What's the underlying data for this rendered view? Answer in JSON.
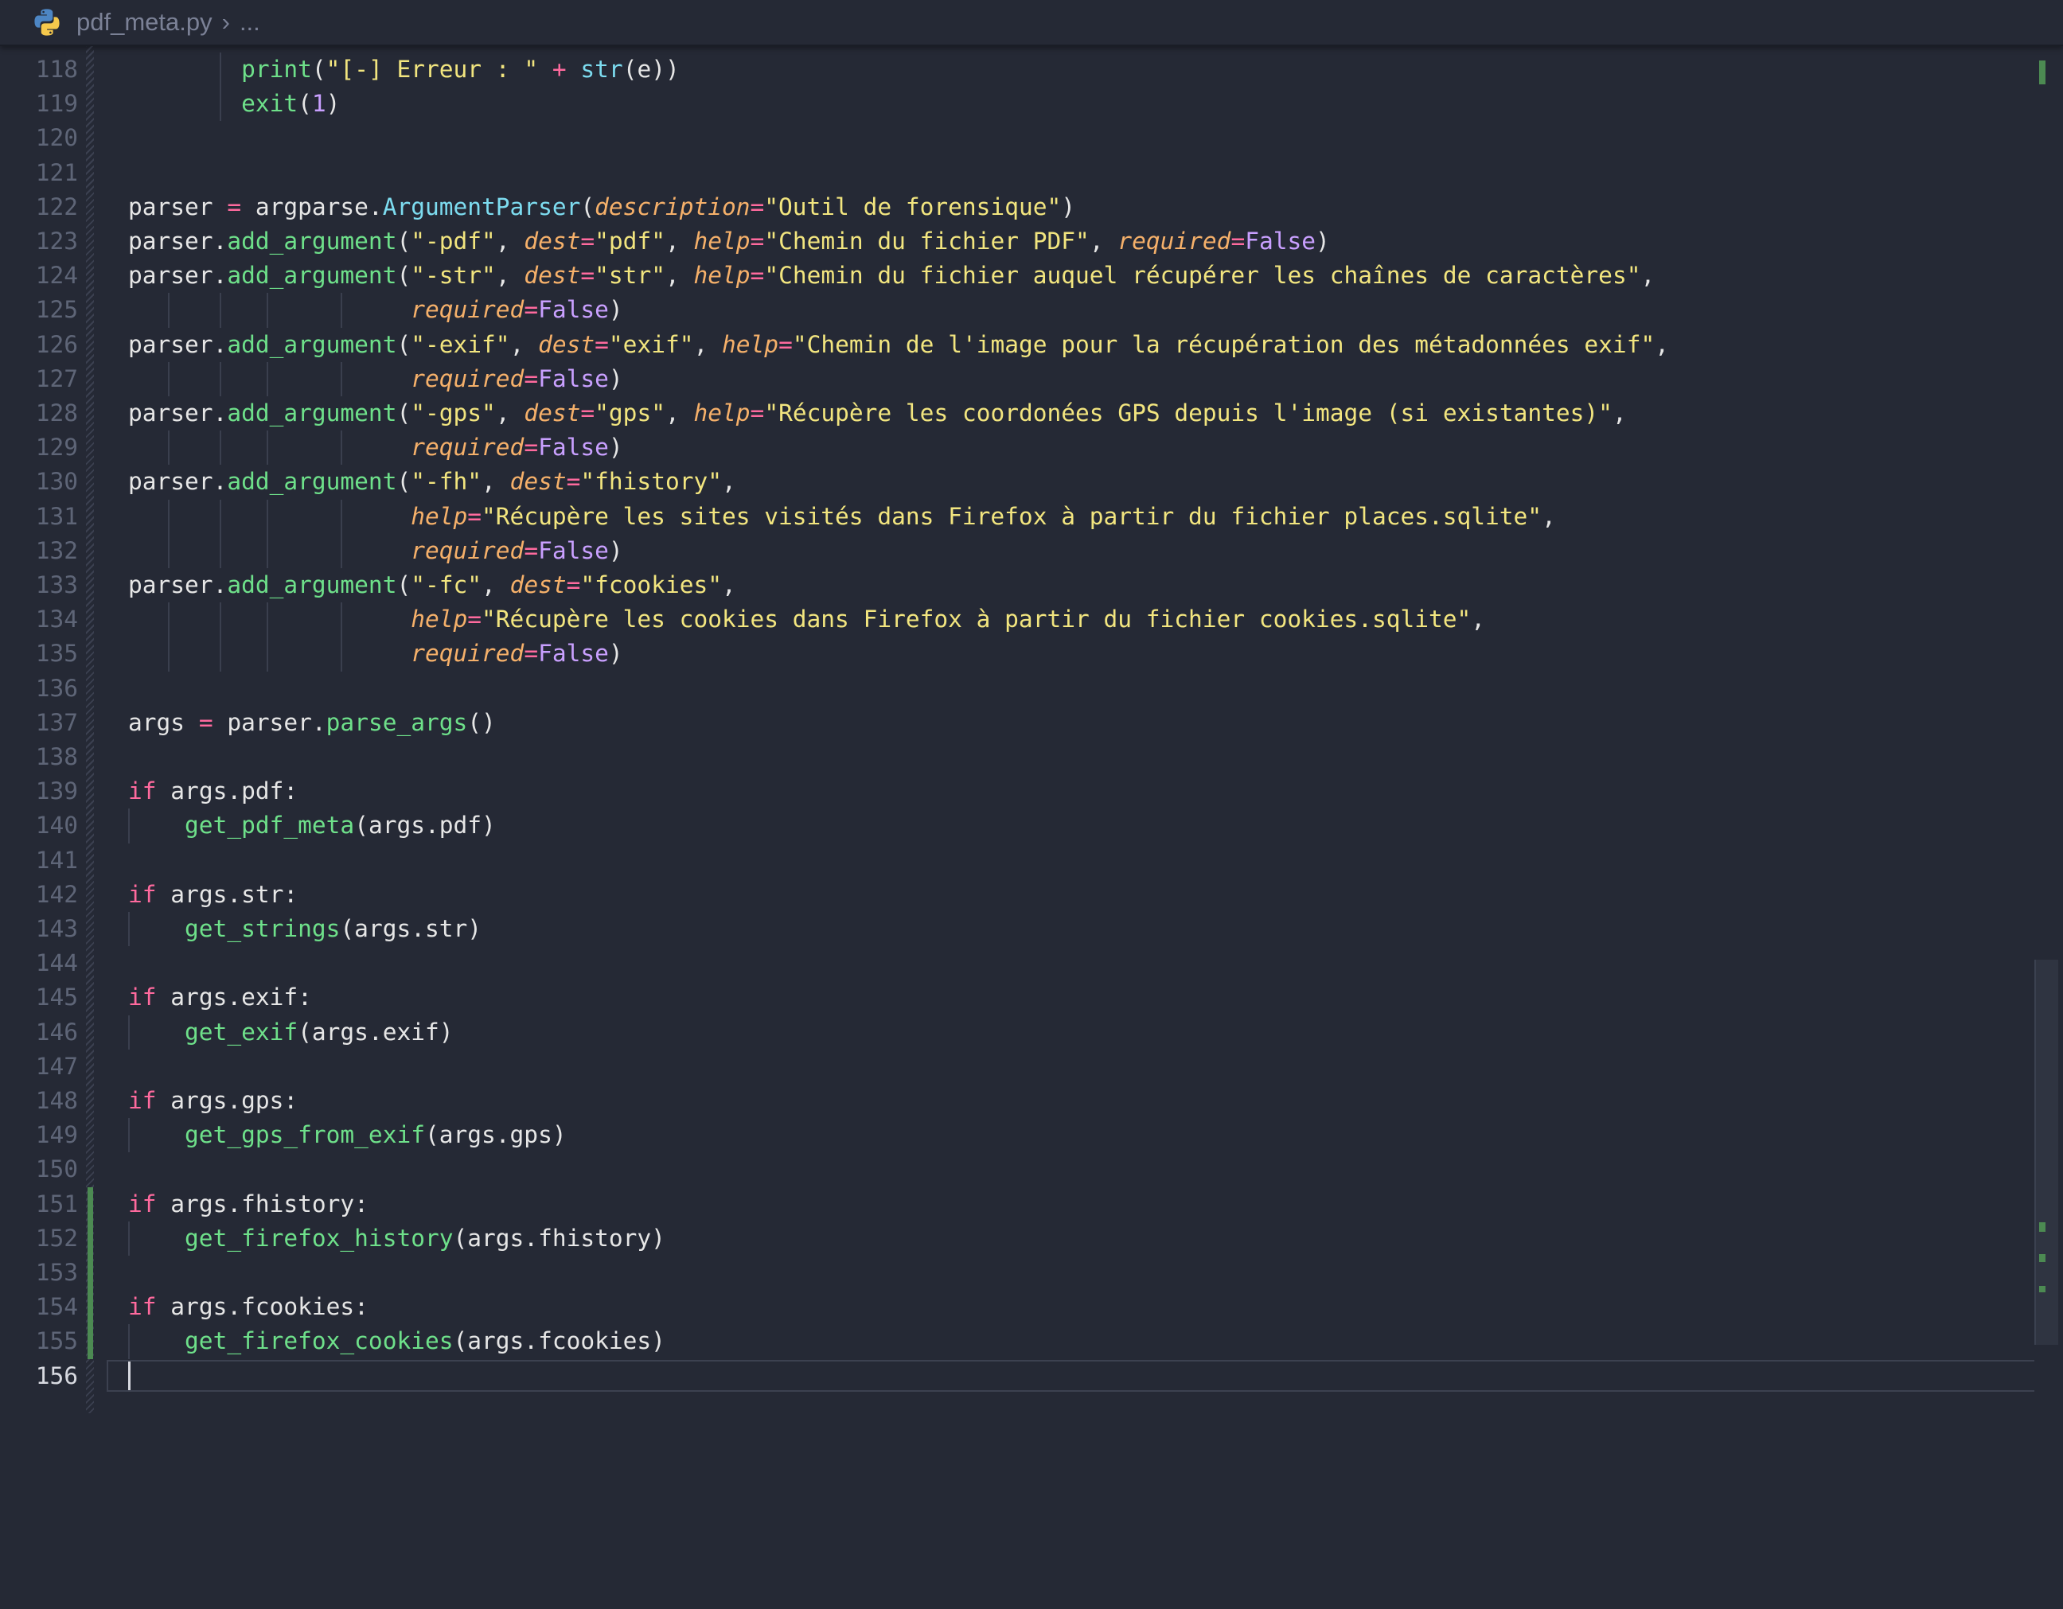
{
  "breadcrumb": {
    "file": "pdf_meta.py",
    "separator": "›",
    "more": "..."
  },
  "code_lines": [
    {
      "n": "118",
      "indent_guides": [
        2
      ],
      "tokens": [
        {
          "t": "fn",
          "v": "print"
        },
        {
          "t": "txt",
          "v": "("
        },
        {
          "t": "str",
          "v": "\"[-] Erreur : \""
        },
        {
          "t": "txt",
          "v": " "
        },
        {
          "t": "op",
          "v": "+"
        },
        {
          "t": "txt",
          "v": " "
        },
        {
          "t": "cls",
          "v": "str"
        },
        {
          "t": "txt",
          "v": "(e))"
        }
      ],
      "lead": "        "
    },
    {
      "n": "119",
      "indent_guides": [
        2
      ],
      "tokens": [
        {
          "t": "fn",
          "v": "exit"
        },
        {
          "t": "txt",
          "v": "("
        },
        {
          "t": "num",
          "v": "1"
        },
        {
          "t": "txt",
          "v": ")"
        }
      ],
      "lead": "        "
    },
    {
      "n": "120",
      "tokens": [],
      "lead": ""
    },
    {
      "n": "121",
      "tokens": [],
      "lead": ""
    },
    {
      "n": "122",
      "tokens": [
        {
          "t": "txt",
          "v": "parser "
        },
        {
          "t": "op",
          "v": "="
        },
        {
          "t": "txt",
          "v": " argparse."
        },
        {
          "t": "cls",
          "v": "ArgumentParser"
        },
        {
          "t": "txt",
          "v": "("
        },
        {
          "t": "par",
          "v": "description"
        },
        {
          "t": "op",
          "v": "="
        },
        {
          "t": "str",
          "v": "\"Outil de forensique\""
        },
        {
          "t": "txt",
          "v": ")"
        }
      ],
      "lead": ""
    },
    {
      "n": "123",
      "tokens": [
        {
          "t": "txt",
          "v": "parser."
        },
        {
          "t": "fn",
          "v": "add_argument"
        },
        {
          "t": "txt",
          "v": "("
        },
        {
          "t": "str",
          "v": "\"-pdf\""
        },
        {
          "t": "txt",
          "v": ", "
        },
        {
          "t": "par",
          "v": "dest"
        },
        {
          "t": "op",
          "v": "="
        },
        {
          "t": "str",
          "v": "\"pdf\""
        },
        {
          "t": "txt",
          "v": ", "
        },
        {
          "t": "par",
          "v": "help"
        },
        {
          "t": "op",
          "v": "="
        },
        {
          "t": "str",
          "v": "\"Chemin du fichier PDF\""
        },
        {
          "t": "txt",
          "v": ", "
        },
        {
          "t": "par",
          "v": "required"
        },
        {
          "t": "op",
          "v": "="
        },
        {
          "t": "bool",
          "v": "False"
        },
        {
          "t": "txt",
          "v": ")"
        }
      ],
      "lead": ""
    },
    {
      "n": "124",
      "tokens": [
        {
          "t": "txt",
          "v": "parser."
        },
        {
          "t": "fn",
          "v": "add_argument"
        },
        {
          "t": "txt",
          "v": "("
        },
        {
          "t": "str",
          "v": "\"-str\""
        },
        {
          "t": "txt",
          "v": ", "
        },
        {
          "t": "par",
          "v": "dest"
        },
        {
          "t": "op",
          "v": "="
        },
        {
          "t": "str",
          "v": "\"str\""
        },
        {
          "t": "txt",
          "v": ", "
        },
        {
          "t": "par",
          "v": "help"
        },
        {
          "t": "op",
          "v": "="
        },
        {
          "t": "str",
          "v": "\"Chemin du fichier auquel récupérer les chaînes de caractères\""
        },
        {
          "t": "txt",
          "v": ","
        }
      ],
      "lead": ""
    },
    {
      "n": "125",
      "indent_guides": [
        1,
        2,
        3,
        4
      ],
      "tokens": [
        {
          "t": "par",
          "v": "required"
        },
        {
          "t": "op",
          "v": "="
        },
        {
          "t": "bool",
          "v": "False"
        },
        {
          "t": "txt",
          "v": ")"
        }
      ],
      "lead": "                    "
    },
    {
      "n": "126",
      "tokens": [
        {
          "t": "txt",
          "v": "parser."
        },
        {
          "t": "fn",
          "v": "add_argument"
        },
        {
          "t": "txt",
          "v": "("
        },
        {
          "t": "str",
          "v": "\"-exif\""
        },
        {
          "t": "txt",
          "v": ", "
        },
        {
          "t": "par",
          "v": "dest"
        },
        {
          "t": "op",
          "v": "="
        },
        {
          "t": "str",
          "v": "\"exif\""
        },
        {
          "t": "txt",
          "v": ", "
        },
        {
          "t": "par",
          "v": "help"
        },
        {
          "t": "op",
          "v": "="
        },
        {
          "t": "str",
          "v": "\"Chemin de l'image pour la récupération des métadonnées exif\""
        },
        {
          "t": "txt",
          "v": ","
        }
      ],
      "lead": ""
    },
    {
      "n": "127",
      "indent_guides": [
        1,
        2,
        3,
        4
      ],
      "tokens": [
        {
          "t": "par",
          "v": "required"
        },
        {
          "t": "op",
          "v": "="
        },
        {
          "t": "bool",
          "v": "False"
        },
        {
          "t": "txt",
          "v": ")"
        }
      ],
      "lead": "                    "
    },
    {
      "n": "128",
      "tokens": [
        {
          "t": "txt",
          "v": "parser."
        },
        {
          "t": "fn",
          "v": "add_argument"
        },
        {
          "t": "txt",
          "v": "("
        },
        {
          "t": "str",
          "v": "\"-gps\""
        },
        {
          "t": "txt",
          "v": ", "
        },
        {
          "t": "par",
          "v": "dest"
        },
        {
          "t": "op",
          "v": "="
        },
        {
          "t": "str",
          "v": "\"gps\""
        },
        {
          "t": "txt",
          "v": ", "
        },
        {
          "t": "par",
          "v": "help"
        },
        {
          "t": "op",
          "v": "="
        },
        {
          "t": "str",
          "v": "\"Récupère les coordonées GPS depuis l'image (si existantes)\""
        },
        {
          "t": "txt",
          "v": ","
        }
      ],
      "lead": ""
    },
    {
      "n": "129",
      "indent_guides": [
        1,
        2,
        3,
        4
      ],
      "tokens": [
        {
          "t": "par",
          "v": "required"
        },
        {
          "t": "op",
          "v": "="
        },
        {
          "t": "bool",
          "v": "False"
        },
        {
          "t": "txt",
          "v": ")"
        }
      ],
      "lead": "                    "
    },
    {
      "n": "130",
      "tokens": [
        {
          "t": "txt",
          "v": "parser."
        },
        {
          "t": "fn",
          "v": "add_argument"
        },
        {
          "t": "txt",
          "v": "("
        },
        {
          "t": "str",
          "v": "\"-fh\""
        },
        {
          "t": "txt",
          "v": ", "
        },
        {
          "t": "par",
          "v": "dest"
        },
        {
          "t": "op",
          "v": "="
        },
        {
          "t": "str",
          "v": "\"fhistory\""
        },
        {
          "t": "txt",
          "v": ","
        }
      ],
      "lead": ""
    },
    {
      "n": "131",
      "indent_guides": [
        1,
        2,
        3,
        4
      ],
      "tokens": [
        {
          "t": "par",
          "v": "help"
        },
        {
          "t": "op",
          "v": "="
        },
        {
          "t": "str",
          "v": "\"Récupère les sites visités dans Firefox à partir du fichier places.sqlite\""
        },
        {
          "t": "txt",
          "v": ","
        }
      ],
      "lead": "                    "
    },
    {
      "n": "132",
      "indent_guides": [
        1,
        2,
        3,
        4
      ],
      "tokens": [
        {
          "t": "par",
          "v": "required"
        },
        {
          "t": "op",
          "v": "="
        },
        {
          "t": "bool",
          "v": "False"
        },
        {
          "t": "txt",
          "v": ")"
        }
      ],
      "lead": "                    "
    },
    {
      "n": "133",
      "tokens": [
        {
          "t": "txt",
          "v": "parser."
        },
        {
          "t": "fn",
          "v": "add_argument"
        },
        {
          "t": "txt",
          "v": "("
        },
        {
          "t": "str",
          "v": "\"-fc\""
        },
        {
          "t": "txt",
          "v": ", "
        },
        {
          "t": "par",
          "v": "dest"
        },
        {
          "t": "op",
          "v": "="
        },
        {
          "t": "str",
          "v": "\"fcookies\""
        },
        {
          "t": "txt",
          "v": ","
        }
      ],
      "lead": ""
    },
    {
      "n": "134",
      "indent_guides": [
        1,
        2,
        3,
        4
      ],
      "tokens": [
        {
          "t": "par",
          "v": "help"
        },
        {
          "t": "op",
          "v": "="
        },
        {
          "t": "str",
          "v": "\"Récupère les cookies dans Firefox à partir du fichier cookies.sqlite\""
        },
        {
          "t": "txt",
          "v": ","
        }
      ],
      "lead": "                    "
    },
    {
      "n": "135",
      "indent_guides": [
        1,
        2,
        3,
        4
      ],
      "tokens": [
        {
          "t": "par",
          "v": "required"
        },
        {
          "t": "op",
          "v": "="
        },
        {
          "t": "bool",
          "v": "False"
        },
        {
          "t": "txt",
          "v": ")"
        }
      ],
      "lead": "                    "
    },
    {
      "n": "136",
      "tokens": [],
      "lead": ""
    },
    {
      "n": "137",
      "tokens": [
        {
          "t": "txt",
          "v": "args "
        },
        {
          "t": "op",
          "v": "="
        },
        {
          "t": "txt",
          "v": " parser."
        },
        {
          "t": "fn",
          "v": "parse_args"
        },
        {
          "t": "txt",
          "v": "()"
        }
      ],
      "lead": ""
    },
    {
      "n": "138",
      "tokens": [],
      "lead": ""
    },
    {
      "n": "139",
      "tokens": [
        {
          "t": "kw",
          "v": "if"
        },
        {
          "t": "txt",
          "v": " args.pdf:"
        }
      ],
      "lead": ""
    },
    {
      "n": "140",
      "indent_guides": [
        0
      ],
      "tokens": [
        {
          "t": "fn",
          "v": "get_pdf_meta"
        },
        {
          "t": "txt",
          "v": "(args.pdf)"
        }
      ],
      "lead": "    "
    },
    {
      "n": "141",
      "tokens": [],
      "lead": ""
    },
    {
      "n": "142",
      "tokens": [
        {
          "t": "kw",
          "v": "if"
        },
        {
          "t": "txt",
          "v": " args.str:"
        }
      ],
      "lead": ""
    },
    {
      "n": "143",
      "indent_guides": [
        0
      ],
      "tokens": [
        {
          "t": "fn",
          "v": "get_strings"
        },
        {
          "t": "txt",
          "v": "(args.str)"
        }
      ],
      "lead": "    "
    },
    {
      "n": "144",
      "tokens": [],
      "lead": ""
    },
    {
      "n": "145",
      "tokens": [
        {
          "t": "kw",
          "v": "if"
        },
        {
          "t": "txt",
          "v": " args.exif:"
        }
      ],
      "lead": ""
    },
    {
      "n": "146",
      "indent_guides": [
        0
      ],
      "tokens": [
        {
          "t": "fn",
          "v": "get_exif"
        },
        {
          "t": "txt",
          "v": "(args.exif)"
        }
      ],
      "lead": "    "
    },
    {
      "n": "147",
      "tokens": [],
      "lead": ""
    },
    {
      "n": "148",
      "tokens": [
        {
          "t": "kw",
          "v": "if"
        },
        {
          "t": "txt",
          "v": " args.gps:"
        }
      ],
      "lead": ""
    },
    {
      "n": "149",
      "indent_guides": [
        0
      ],
      "tokens": [
        {
          "t": "fn",
          "v": "get_gps_from_exif"
        },
        {
          "t": "txt",
          "v": "(args.gps)"
        }
      ],
      "lead": "    "
    },
    {
      "n": "150",
      "tokens": [],
      "lead": ""
    },
    {
      "n": "151",
      "tokens": [
        {
          "t": "kw",
          "v": "if"
        },
        {
          "t": "txt",
          "v": " args.fhistory:"
        }
      ],
      "lead": ""
    },
    {
      "n": "152",
      "indent_guides": [
        0
      ],
      "tokens": [
        {
          "t": "fn",
          "v": "get_firefox_history"
        },
        {
          "t": "txt",
          "v": "(args.fhistory)"
        }
      ],
      "lead": "    "
    },
    {
      "n": "153",
      "tokens": [],
      "lead": ""
    },
    {
      "n": "154",
      "tokens": [
        {
          "t": "kw",
          "v": "if"
        },
        {
          "t": "txt",
          "v": " args.fcookies:"
        }
      ],
      "lead": ""
    },
    {
      "n": "155",
      "indent_guides": [
        0
      ],
      "tokens": [
        {
          "t": "fn",
          "v": "get_firefox_cookies"
        },
        {
          "t": "txt",
          "v": "(args.fcookies)"
        }
      ],
      "lead": "    "
    },
    {
      "n": "156",
      "tokens": [],
      "lead": "",
      "active": true
    }
  ],
  "git_added_lines": [
    "151",
    "152",
    "153",
    "154",
    "155"
  ],
  "colors": {
    "background": "#252935",
    "keyword": "#ff6a9e",
    "function": "#6ee08a",
    "class": "#7ddcf0",
    "string": "#f2e57f",
    "parameter": "#f5b06a",
    "boolean": "#c9a0ff",
    "git_added": "#4c8a52"
  }
}
